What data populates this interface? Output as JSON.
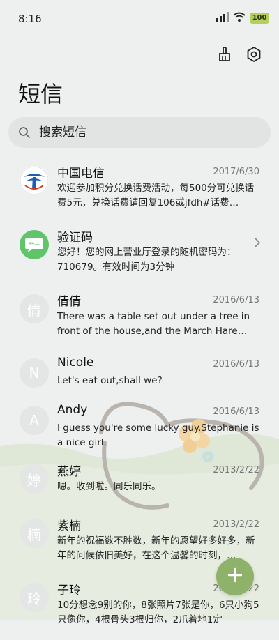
{
  "status": {
    "time": "8:16",
    "battery": "100"
  },
  "header": {
    "title": "短信"
  },
  "search": {
    "placeholder": "搜索短信"
  },
  "conversations": [
    {
      "name": "中国电信",
      "date": "2017/6/30",
      "snippet": "欢迎参加积分兑换话费活动，每500分可兑换话费5元，兑换话费请回复106或jfdh#话费…",
      "avatar": "china-telecom-logo"
    },
    {
      "name": "验证码",
      "date": "",
      "snippet": "您好！您的网上营业厅登录的随机密码为：710679。有效时间为3分钟",
      "avatar": "message-icon"
    },
    {
      "name": "倩倩",
      "date": "2016/6/13",
      "snippet": "There was a table set out under a tree in front of the house,and the March Hare an…",
      "avatar_letter": "倩"
    },
    {
      "name": "Nicole",
      "date": "2016/6/13",
      "snippet": "Let's eat out,shall we?",
      "avatar_letter": "N"
    },
    {
      "name": "Andy",
      "date": "2016/6/13",
      "snippet": "I guess you're some lucky guy.Stephanie is a nice girl.",
      "avatar_letter": "A"
    },
    {
      "name": "燕婷",
      "date": "2013/2/22",
      "snippet": "嗯。收到啦。同乐同乐。",
      "avatar_letter": "婷"
    },
    {
      "name": "紫楠",
      "date": "2013/2/22",
      "snippet": "新年的祝福数不胜数，新年的愿望好多好多，新年的问候依旧美好，在这个温馨的时刻，…",
      "avatar_letter": "楠"
    },
    {
      "name": "子玲",
      "date": "2013/2/22",
      "snippet": "10分想念9别的你，8张照片7张是你，6只小狗5只像你，4根骨头3根归你，2爪着地1定",
      "avatar_letter": "玲"
    }
  ],
  "colors": {
    "accent": "#8fb26a",
    "telecom_blue": "#1a5fb4",
    "message_green": "#5fc46a"
  }
}
